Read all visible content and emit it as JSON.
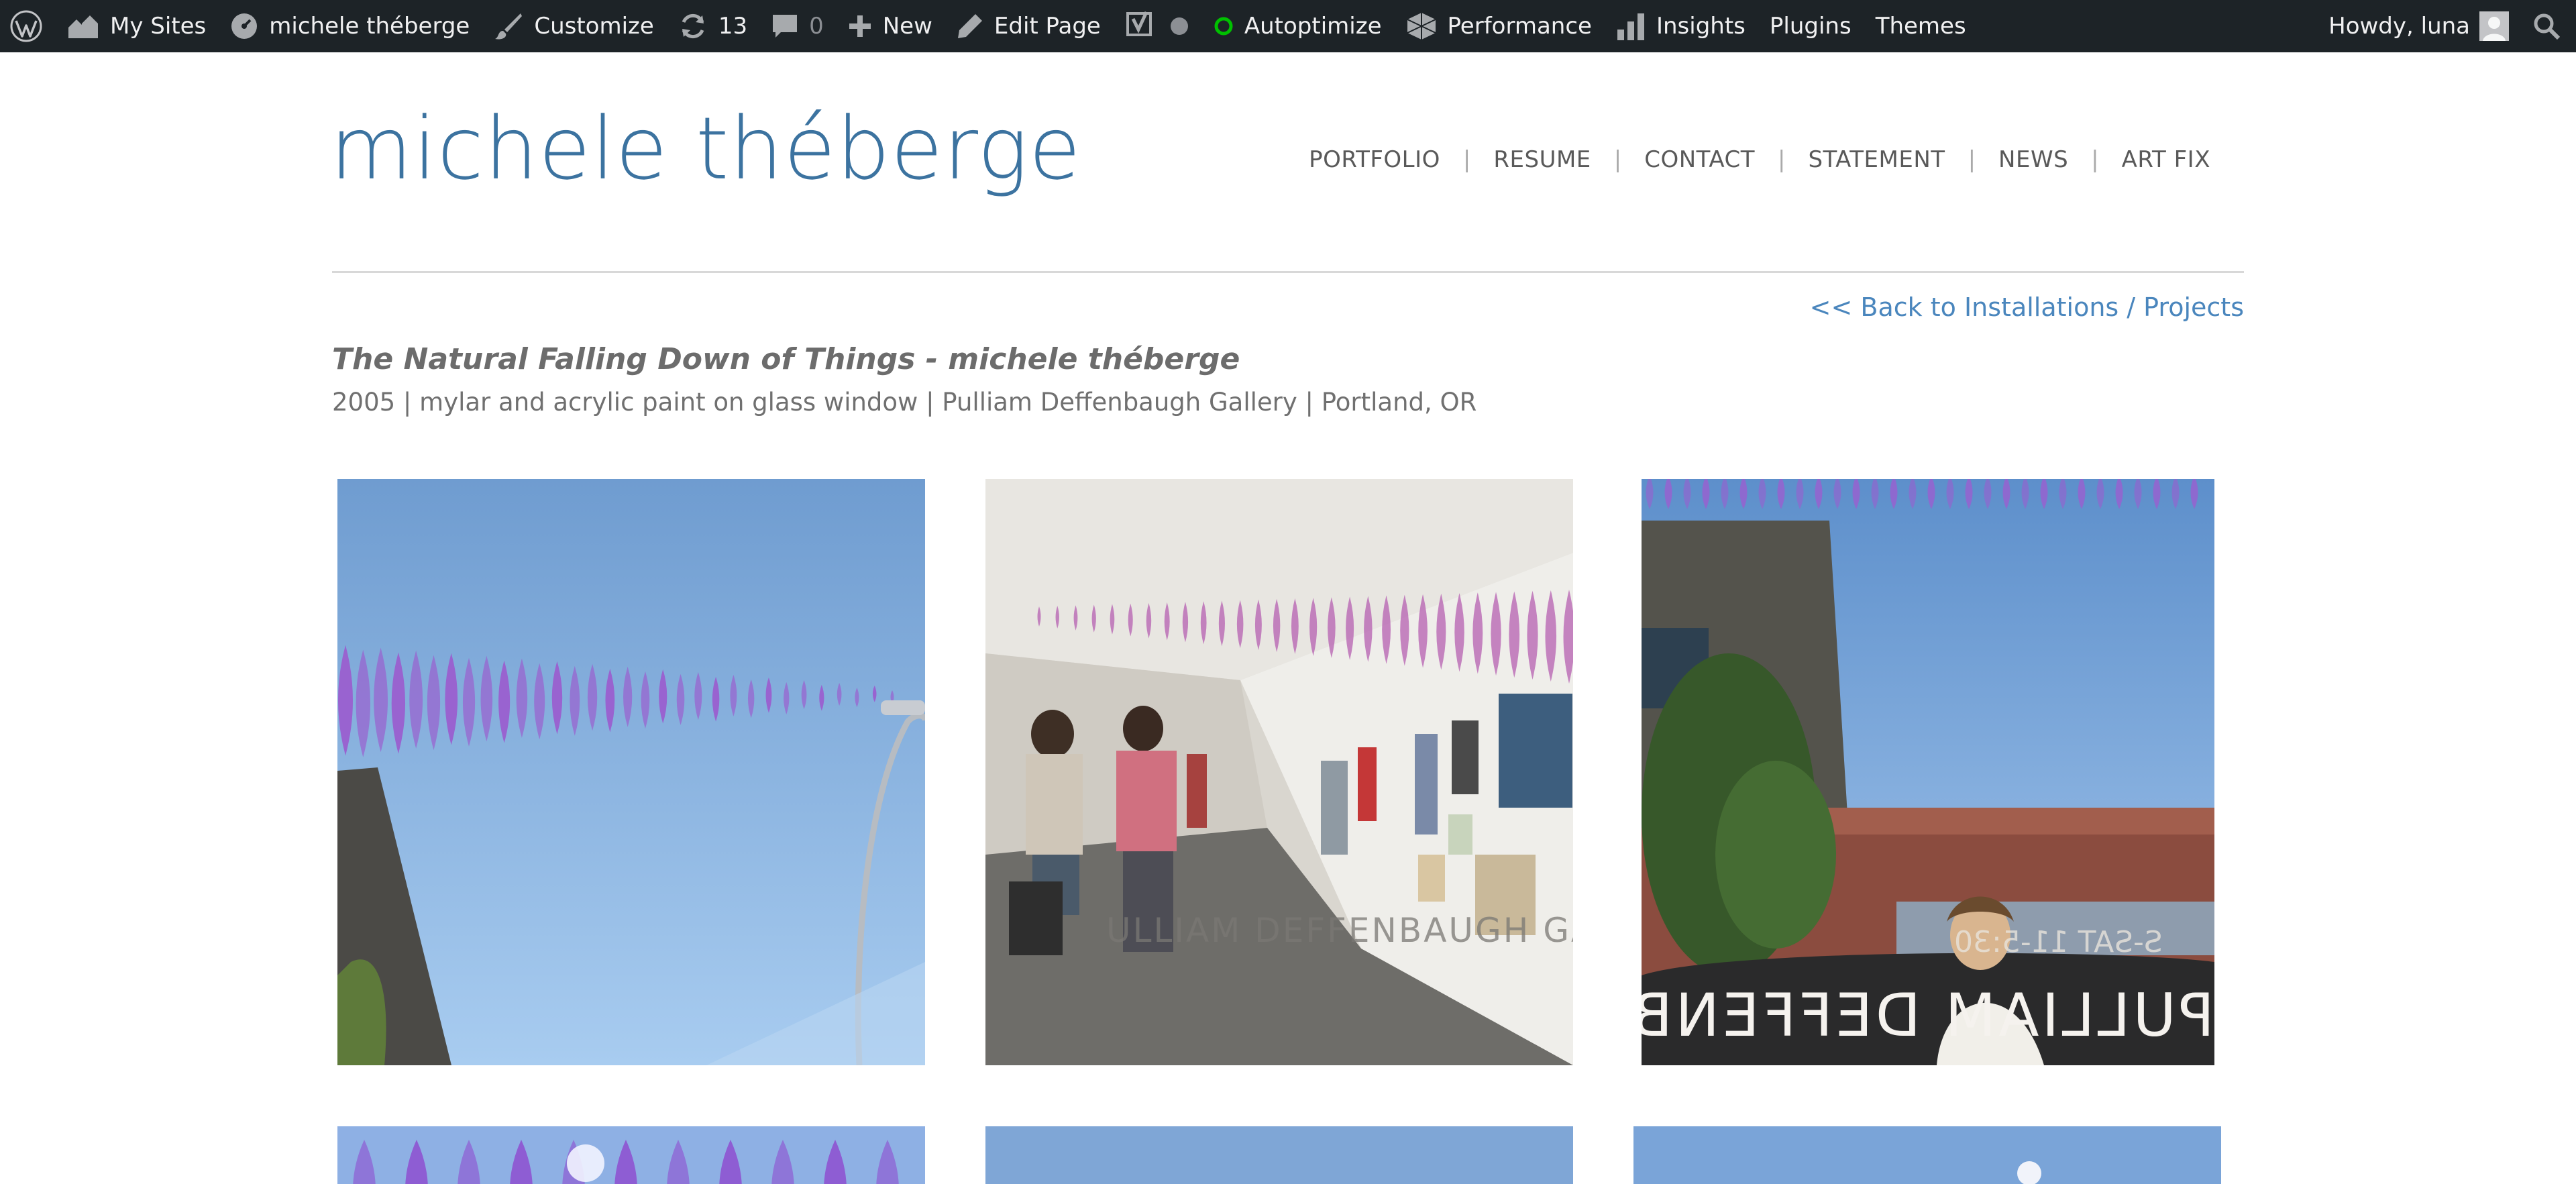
{
  "admin_bar": {
    "my_sites": "My Sites",
    "site_name": "michele théberge",
    "customize": "Customize",
    "updates_count": "13",
    "comments_count": "0",
    "new": "New",
    "edit_page": "Edit Page",
    "autoptimize": "Autoptimize",
    "performance": "Performance",
    "insights": "Insights",
    "plugins": "Plugins",
    "themes": "Themes",
    "greeting": "Howdy, luna",
    "status_color": "#00c000"
  },
  "header": {
    "site_title": "michele théberge",
    "nav": [
      {
        "label": "PORTFOLIO"
      },
      {
        "label": "RESUME"
      },
      {
        "label": "CONTACT"
      },
      {
        "label": "STATEMENT"
      },
      {
        "label": "NEWS"
      },
      {
        "label": "ART FIX"
      }
    ],
    "nav_separator": "|"
  },
  "content": {
    "back_link": "<< Back to Installations / Projects",
    "title": "The Natural Falling Down of Things - michele théberge",
    "meta": "2005 | mylar and acrylic paint on glass window | Pulliam Deffenbaugh Gallery | Portland, OR",
    "gallery": [
      {
        "scene": "sky-with-mylar-leaves-and-streetlamp"
      },
      {
        "scene": "gallery-interior-with-visitors"
      },
      {
        "scene": "street-view-through-gallery-window"
      },
      {
        "scene": "mylar-leaves-close-up"
      },
      {
        "scene": "sky"
      },
      {
        "scene": "sky"
      }
    ],
    "window_text": {
      "photo2": "ULLIAM DEFFENBAUGH GALLERY",
      "photo3_hours": "S-SAT 11-5:30",
      "photo3_mirror": "PULLIAM DEFFENB"
    }
  },
  "colors": {
    "admin_bg": "#1d2327",
    "title_blue": "#3c73a0",
    "link_blue": "#4a86bd",
    "mylar_purple": "#9a5fcf"
  }
}
